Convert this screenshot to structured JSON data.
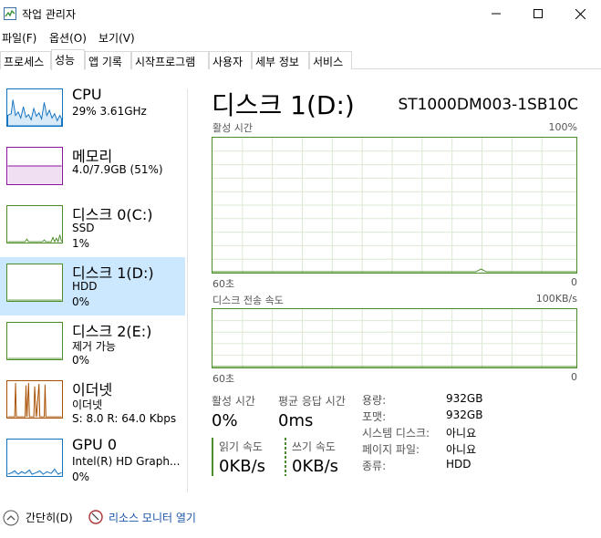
{
  "window": {
    "title": "작업 관리자"
  },
  "menu": [
    "파일(F)",
    "옵션(O)",
    "보기(V)"
  ],
  "tabs": [
    "프로세스",
    "성능",
    "앱 기록",
    "시작프로그램",
    "사용자",
    "세부 정보",
    "서비스"
  ],
  "active_tab": "성능",
  "sidebar": [
    {
      "name": "CPU",
      "line2": "29%  3.61GHz",
      "line3": "",
      "color": "#1172c0"
    },
    {
      "name": "메모리",
      "line2": "4.0/7.9GB (51%)",
      "line3": "",
      "color": "#8b129c"
    },
    {
      "name": "디스크 0(C:)",
      "line2": "SSD",
      "line3": "1%",
      "color": "#4d8c2a"
    },
    {
      "name": "디스크 1(D:)",
      "line2": "HDD",
      "line3": "0%",
      "color": "#4d8c2a"
    },
    {
      "name": "디스크 2(E:)",
      "line2": "제거 가능",
      "line3": "0%",
      "color": "#4d8c2a"
    },
    {
      "name": "이더넷",
      "line2": "이더넷",
      "line3": "S: 8.0  R: 64.0 Kbps",
      "color": "#a74f01"
    },
    {
      "name": "GPU 0",
      "line2": "Intel(R) HD Graph...",
      "line3": "0%",
      "color": "#1172c0"
    }
  ],
  "selected_index": 3,
  "main": {
    "title": "디스크 1(D:)",
    "model": "ST1000DM003-1SB10C",
    "graph1": {
      "label": "활성 시간",
      "max": "100%",
      "time": "60초",
      "min": "0"
    },
    "graph2": {
      "label": "디스크 전송 속도",
      "max": "100KB/s",
      "time": "60초",
      "min": "0"
    },
    "stats": {
      "active_label": "활성 시간",
      "active_value": "0%",
      "resp_label": "평균 응답 시간",
      "resp_value": "0ms",
      "read_label": "읽기 속도",
      "read_value": "0KB/s",
      "write_label": "쓰기 속도",
      "write_value": "0KB/s"
    },
    "info": [
      {
        "label": "용량:",
        "value": "932GB"
      },
      {
        "label": "포맷:",
        "value": "932GB"
      },
      {
        "label": "시스템 디스크:",
        "value": "아니요"
      },
      {
        "label": "페이지 파일:",
        "value": "아니요"
      },
      {
        "label": "종류:",
        "value": "HDD"
      }
    ]
  },
  "footer": {
    "brief": "간단히(D)",
    "monitor": "리소스 모니터 열기"
  },
  "colors": {
    "disk": "#4d8c2a",
    "selected_bg": "#cce8ff",
    "cpu": "#1172c0",
    "memory": "#8b129c",
    "ethernet": "#a74f01"
  }
}
